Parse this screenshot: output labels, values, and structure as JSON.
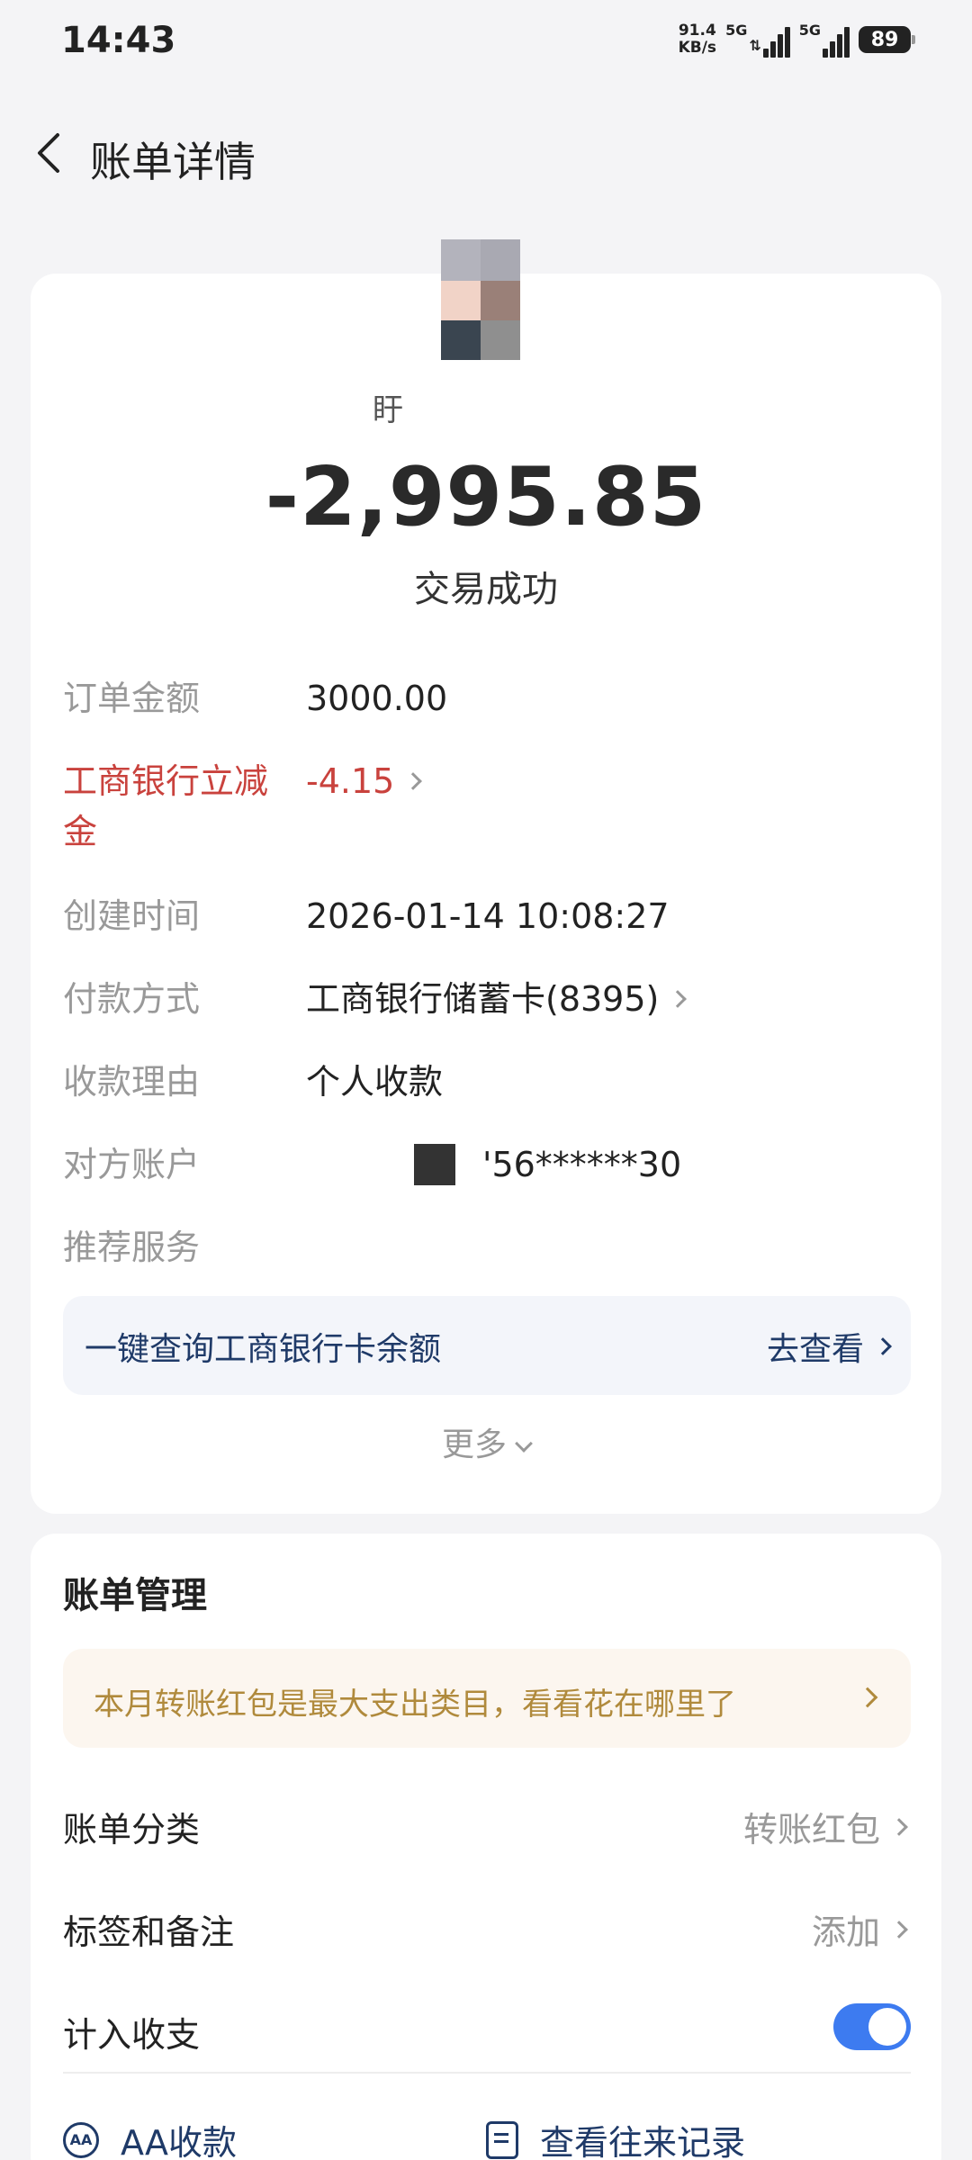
{
  "status_bar": {
    "time": "14:43",
    "net_speed_value": "91.4",
    "net_speed_unit": "KB/s",
    "signal_1_label": "5G",
    "signal_2_label": "5G",
    "battery": "89"
  },
  "nav": {
    "title": "账单详情"
  },
  "header": {
    "name_fragment": "盱",
    "amount": "-2,995.85",
    "status": "交易成功"
  },
  "details": [
    {
      "label": "订单金额",
      "value": "3000.00"
    },
    {
      "label": "工商银行立减金",
      "value": "-4.15"
    },
    {
      "label": "创建时间",
      "value": "2026-01-14 10:08:27"
    },
    {
      "label": "付款方式",
      "value": "工商银行储蓄卡(8395)"
    },
    {
      "label": "收款理由",
      "value": "个人收款"
    },
    {
      "label": "对方账户",
      "value": "'56******30"
    },
    {
      "label": "推荐服务",
      "value": ""
    }
  ],
  "service": {
    "text": "一键查询工商银行卡余额",
    "link": "去查看"
  },
  "more": "更多",
  "management": {
    "title": "账单管理",
    "tip": "本月转账红包是最大支出类目，看看花在哪里了",
    "category_label": "账单分类",
    "category_value": "转账红包",
    "tags_label": "标签和备注",
    "tags_value": "添加",
    "count_label": "计入收支",
    "count_enabled": true,
    "aa_label": "AA收款",
    "aa_icon_text": "AA",
    "records_label": "查看往来记录"
  },
  "colors": {
    "accent_blue": "#3d7bf0",
    "link_navy": "#1f3a68",
    "discount_red": "#c9423d",
    "tip_gold": "#b08a3c"
  }
}
